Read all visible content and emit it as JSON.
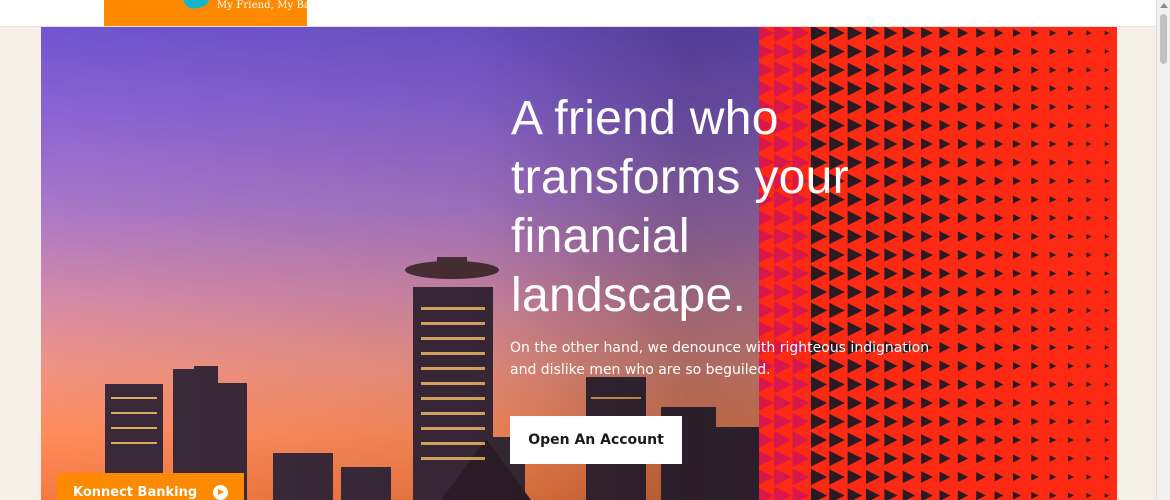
{
  "header": {
    "tagline": "My Friend, My Bank"
  },
  "hero": {
    "heading": "A friend who transforms your financial landscape.",
    "subtext": "On the other hand, we denounce with righteous indignation and dislike men who are so beguiled.",
    "cta_label": "Open An Account",
    "side_button_label": "Konnect Banking"
  },
  "icons": {
    "side_button_icon": "play-circle-icon",
    "logo_icon": "brand-logo-icon"
  },
  "colors": {
    "brand_orange": "#ff8a00",
    "pattern_red": "#ff2a14",
    "logo_teal": "#16b6c9"
  }
}
